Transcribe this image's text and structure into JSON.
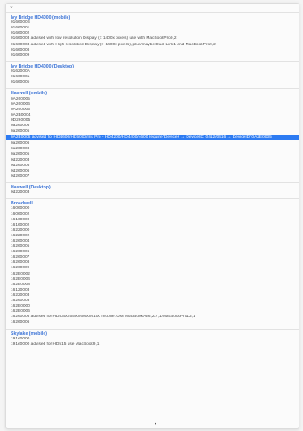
{
  "top": {
    "chevron": "chevron-down-icon"
  },
  "groups": [
    {
      "header": "Ivy Bridge HD4000 (mobile)",
      "rows": [
        "0166000B",
        "01660001",
        "01660002",
        "01660003 advised with low resolution Display (< 1400x pixels) use with MacBookPro9,2",
        "01660004 advised with High resolution Display (> 1400x pixels), plus/maybe Dual Link1 and MacBookPro9,2",
        "01660008",
        "01660009"
      ]
    },
    {
      "header": "Ivy Bridge HD4000 (Desktop)",
      "rows": [
        "0162000A",
        "0166000a",
        "0166000b"
      ]
    },
    {
      "header": "Haswell (mobile)",
      "rows": [
        "0A260005",
        "0A260006",
        "0A260005",
        "0A2B0004",
        "0D260005",
        "0a260006",
        "0a260005",
        "0A2E0005 advised for HD4600/HD5000/Iris Pro - HD4200/HD4400/4600 require 'Devices → DeviceID: 0412/0416 → DeviceID' 0A2E0005",
        "0a260006",
        "0a260008",
        "0a260005",
        "0d220003",
        "0d260005",
        "0d260006",
        "0d260007"
      ],
      "selected_index": 7
    },
    {
      "header": "Haswell (Desktop)",
      "rows": [
        "0d220003"
      ]
    },
    {
      "header": "Broadwell",
      "rows": [
        "16060000",
        "16060002",
        "16160000",
        "16160002",
        "16220000",
        "16220002",
        "16260004",
        "16260005",
        "16260006",
        "16260007",
        "16260008",
        "16260009",
        "162B0002",
        "162B0004",
        "162B0008",
        "16120003",
        "16220003",
        "16260003",
        "162B0000",
        "162B0006",
        "16260006 advised for HD5300/5500/6000/6100 mobile. Use MacBookAir6,2/7,1/MacBookPro12,1",
        "16260006"
      ]
    },
    {
      "header": "Skylake (mobile)",
      "rows": [
        "191e0000",
        "191e0000 advised for HD515 use MacBook9,1"
      ]
    }
  ],
  "footer": {
    "dot": "•"
  }
}
